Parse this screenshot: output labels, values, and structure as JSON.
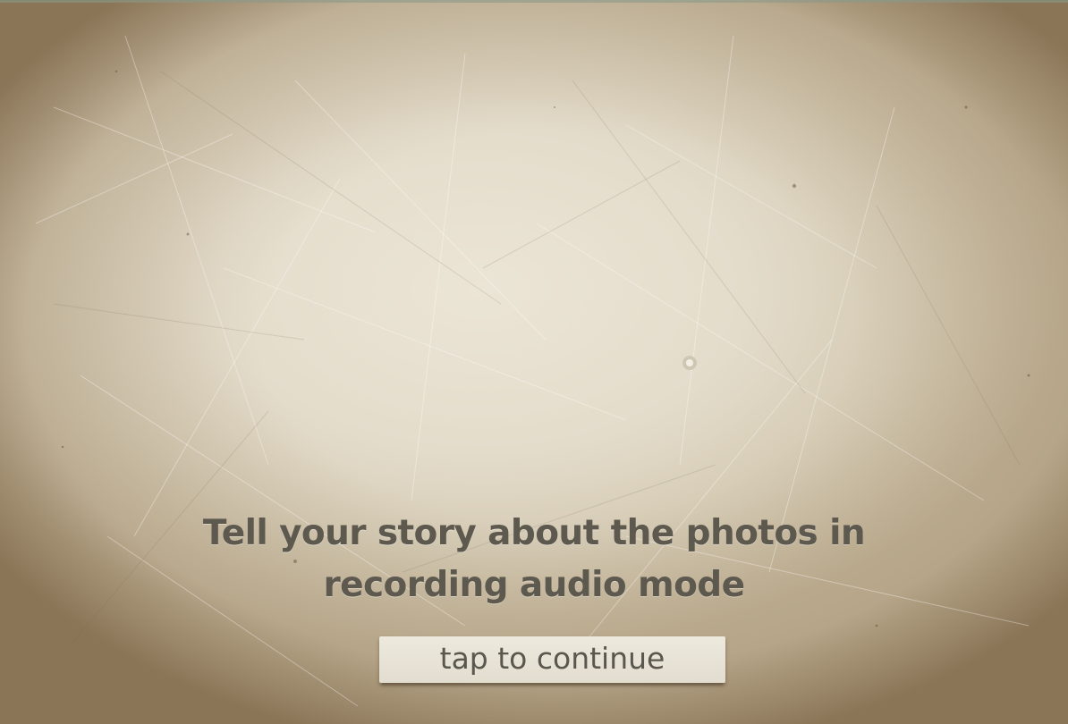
{
  "intro": {
    "headline_line1": "Tell your story about the photos in",
    "headline_line2": "recording audio mode",
    "continue_label": "tap to continue"
  },
  "theme": {
    "paper_color": "#e6dfcf",
    "vignette_color": "#8c7558",
    "text_color": "#5d594f",
    "button_color": "#ebe7db"
  }
}
